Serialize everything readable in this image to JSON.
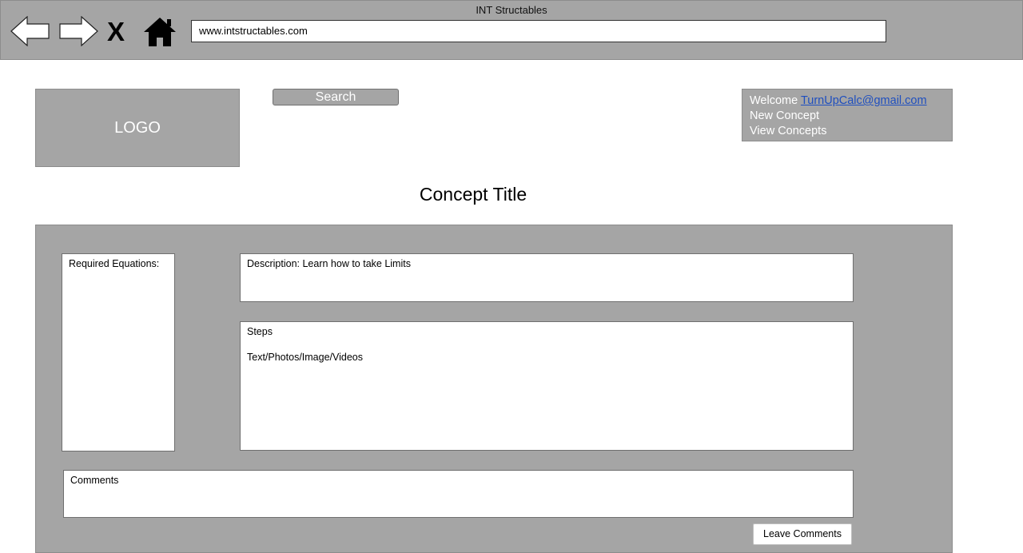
{
  "browser": {
    "window_title": "INT Structables",
    "close_label": "X",
    "url": "www.intstructables.com",
    "icons": {
      "back": "back-arrow-icon",
      "forward": "forward-arrow-icon",
      "home": "home-icon"
    }
  },
  "header": {
    "logo_text": "LOGO",
    "search_label": "Search",
    "user_panel": {
      "welcome_label": "Welcome",
      "email": "TurnUpCalc@gmail.com",
      "new_concept_label": "New Concept",
      "view_concepts_label": "View Concepts"
    }
  },
  "main": {
    "concept_title": "Concept Title",
    "required_equations_label": "Required Equations:",
    "description_text": "Description: Learn how to take Limits",
    "steps_label": "Steps",
    "steps_content": "Text/Photos/Image/Videos",
    "comments_label": "Comments",
    "leave_comments_label": "Leave Comments"
  },
  "colors": {
    "panel_gray": "#a5a5a5",
    "link_blue": "#1f4fbf",
    "white": "#ffffff"
  }
}
